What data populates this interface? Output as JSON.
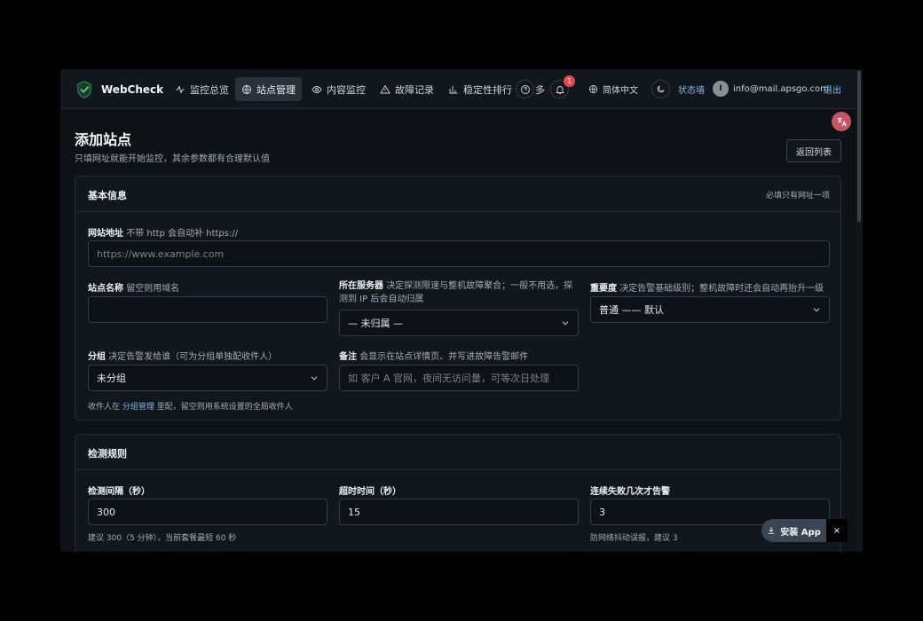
{
  "nav": {
    "brand": "WebCheck",
    "items": [
      {
        "label": "监控总览",
        "icon": "activity-icon"
      },
      {
        "label": "站点管理",
        "icon": "globe-icon",
        "active": true
      },
      {
        "label": "内容监控",
        "icon": "eye-icon"
      },
      {
        "label": "故障记录",
        "icon": "warning-icon"
      },
      {
        "label": "稳定性排行",
        "icon": "bar-chart-icon"
      }
    ],
    "more_label": "多",
    "notifications_count": "1",
    "language": "简体中文",
    "status_label": "状态墙",
    "avatar_letter": "I",
    "user_email": "info@mail.apsgo.com",
    "logout_label": "退出"
  },
  "page": {
    "title": "添加站点",
    "subtitle": "只填网址就能开始监控，其余参数都有合理默认值",
    "back_button": "返回列表"
  },
  "basic": {
    "title": "基本信息",
    "note": "必填只有网址一项",
    "url": {
      "label": "网站地址",
      "hint": "不带 http 会自动补 https://",
      "placeholder": "https://www.example.com"
    },
    "name": {
      "label": "站点名称",
      "hint": "留空则用域名",
      "value": ""
    },
    "server": {
      "label": "所在服务器",
      "hint": "决定探测限速与整机故障聚合；一般不用选，探测到 IP 后会自动归属",
      "value": "— 未归属 —"
    },
    "importance": {
      "label": "重要度",
      "hint": "决定告警基础级别；整机故障时还会自动再抬升一级",
      "value": "普通 —— 默认"
    },
    "group": {
      "label": "分组",
      "hint": "决定告警发给谁（可为分组单独配收件人）",
      "value": "未分组"
    },
    "remark": {
      "label": "备注",
      "hint": "会显示在站点详情页、并写进故障告警邮件",
      "placeholder": "如 客户 A 官网，夜间无访问量，可等次日处理"
    },
    "group_note_prefix": "收件人在",
    "group_note_link": "分组管理",
    "group_note_suffix": "里配，留空则用系统设置的全局收件人"
  },
  "rules": {
    "title": "检测规则",
    "interval": {
      "label": "检测间隔（秒）",
      "value": "300",
      "hint": "建议 300（5 分钟），当前套餐最短 60 秒"
    },
    "timeout": {
      "label": "超时时间（秒）",
      "value": "15"
    },
    "fail_count": {
      "label": "连续失败几次才告警",
      "value": "3",
      "hint": "防网络抖动误报，建议 3"
    }
  },
  "install": {
    "label": "安装 App",
    "close": "×"
  }
}
